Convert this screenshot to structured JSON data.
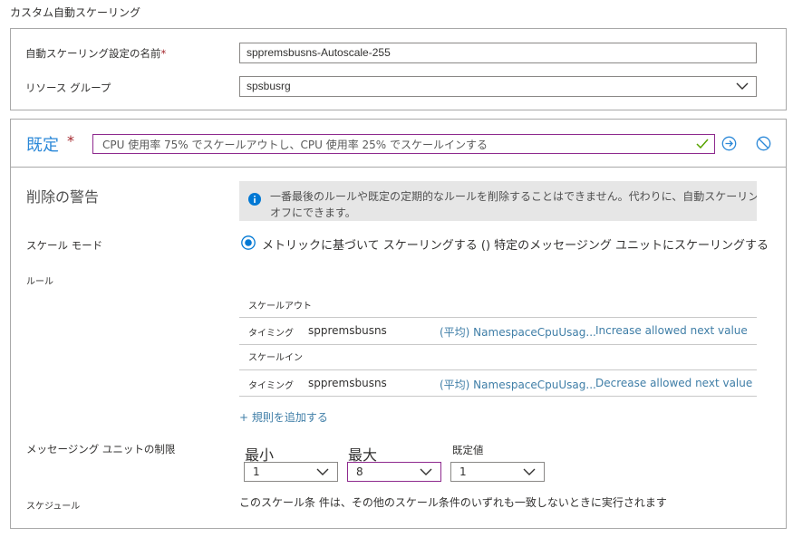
{
  "heading": "カスタム自動スケーリング",
  "settings": {
    "name_label": "自動スケーリング設定の名前",
    "name_required": "*",
    "name_value": "sppremsbusns-Autoscale-255",
    "rg_label": "リソース グループ",
    "rg_value": "spsbusrg"
  },
  "condition": {
    "title": "既定",
    "required": "*",
    "summary": "CPU 使用率 75% でスケールアウトし、CPU 使用率 25% でスケールインする"
  },
  "delete_warning": {
    "label": "削除の警告",
    "line1": "一番最後のルールや既定の定期的なルールを削除することはできません。代わりに、自動スケーリングを無効にして、自動スケーリングを",
    "line2": "オフにできます。"
  },
  "scale_mode": {
    "label": "スケール モード",
    "option": "メトリックに基づいて スケーリングする () 特定のメッセージング ユニットにスケーリングする"
  },
  "rules": {
    "label": "ルール",
    "scale_out_header": "スケールアウト",
    "scale_in_header": "スケールイン",
    "out_rows": [
      {
        "when": "タイミング",
        "resource": "sppremsbusns",
        "metric": "(平均) NamespaceCpuUsag...",
        "action": "Increase allowed next value"
      }
    ],
    "in_rows": [
      {
        "when": "タイミング",
        "resource": "sppremsbusns",
        "metric": "(平均) NamespaceCpuUsag...",
        "action": "Decrease allowed next value"
      }
    ],
    "add_rule": "+ 規則を追加する"
  },
  "limits": {
    "label": "メッセージング ユニットの制限",
    "min_label": "最小",
    "max_label": "最大",
    "default_label": "既定値",
    "min_value": "1",
    "max_value": "8",
    "default_value": "1"
  },
  "schedule": {
    "label": "スケジュール",
    "text": "このスケール条 件は、その他のスケール条件のいずれも一致しないときに実行されます"
  },
  "colors": {
    "accent": "#2b88d8",
    "link": "#3f7ea7",
    "required": "#a4262c",
    "focus_border": "#8e2a8e",
    "check": "#57a300"
  }
}
